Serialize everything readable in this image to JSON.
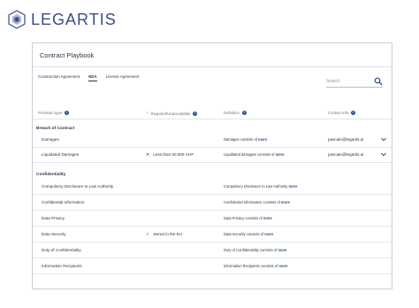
{
  "brand": {
    "name": "LEGARTIS",
    "color": "#3a4d84"
  },
  "panel": {
    "title": "Contract Playbook"
  },
  "tabs": [
    {
      "label": "Construction Agreement",
      "active": false
    },
    {
      "label": "NDA",
      "active": true
    },
    {
      "label": "License Agreement",
      "active": false
    }
  ],
  "search": {
    "placeholder": "Search"
  },
  "columns": {
    "provision": "Provision type",
    "required": "Required/Unacceptable",
    "definition": "Definition",
    "contact": "Contact Info"
  },
  "sections": [
    {
      "title": "Breach of Contract",
      "rows": [
        {
          "name": "Damages",
          "rule_icon": "",
          "rule": "",
          "definition": "Damages consists of",
          "more": "more",
          "contact": "pascale@legartis.ai",
          "expandable": true
        },
        {
          "name": "Liquidated Damages",
          "rule_icon": "✕",
          "rule": "Less than 50.000 CHF",
          "definition": "Liquidated damages consists of",
          "more": "more",
          "contact": "pascale@legartis.ai",
          "expandable": true
        }
      ]
    },
    {
      "title": "Confidentiality",
      "rows": [
        {
          "name": "Compulsory Disclosure to Law Authority",
          "rule_icon": "",
          "rule": "",
          "definition": "Compulsory Disclosure to Law Authority",
          "more": "more",
          "contact": "",
          "expandable": false
        },
        {
          "name": "Confidential Information",
          "rule_icon": "",
          "rule": "",
          "definition": "Confidential Information consists of",
          "more": "more",
          "contact": "",
          "expandable": false
        },
        {
          "name": "Data Privacy",
          "rule_icon": "",
          "rule": "",
          "definition": "Data Privacy consists of",
          "more": "more",
          "contact": "",
          "expandable": false
        },
        {
          "name": "Data Security",
          "rule_icon": "✓",
          "rule": "stored in the EU",
          "definition": "Data Security consists of",
          "more": "more",
          "contact": "",
          "expandable": false
        },
        {
          "name": "Duty of Confidentiality",
          "rule_icon": "",
          "rule": "",
          "definition": "Duty of Confidentiality consists of",
          "more": "more",
          "contact": "",
          "expandable": false
        },
        {
          "name": "Information Recipients",
          "rule_icon": "",
          "rule": "",
          "definition": "Information Recipients consists of",
          "more": "more",
          "contact": "",
          "expandable": false
        }
      ]
    }
  ],
  "icons": {
    "info": "info-icon",
    "search": "search-icon",
    "chevron": "chevron-down-icon",
    "sort": "arrow-up-icon"
  },
  "accent": "#2f4f8f"
}
